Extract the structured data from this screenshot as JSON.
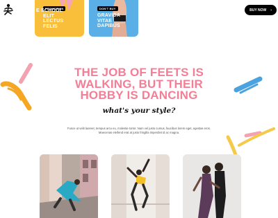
{
  "header": {
    "buy_label": "BUY NOW",
    "buy_arrow": "›"
  },
  "cards": [
    {
      "tag": "PROMOTION",
      "lines": [
        "E SCHOOL",
        "ELIT",
        "LECTUS",
        "FELIS"
      ]
    },
    {
      "tag": "DON'T BUY",
      "lines": [
        "GRAVIDA",
        "VITAE",
        "DAPIBUS"
      ]
    }
  ],
  "hero": {
    "headline_line1": "THE JOB OF FEETS IS",
    "headline_line2": "WALKING, BUT THEIR",
    "headline_line3": "HOBBY IS DANCING",
    "tagline": "what's your style?",
    "body_line1": "Fusce ut velit laoreet, tempus arcu eu, molestie tortor. Nam vel justo cursus, faucibus lorem eget, egestas eros.",
    "body_line2": "Maecenas eleifend erat at justo fringilla imperdiet id ac magna."
  },
  "colors": {
    "accent_pink": "#f47e96",
    "card_yellow": "#f9bf3b",
    "card_blue": "#5ab0e6",
    "brush_orange": "#f5a623",
    "brush_blue": "#4aa3df"
  },
  "icons": [
    "dancer-logo-icon",
    "chevron-right-icon"
  ]
}
